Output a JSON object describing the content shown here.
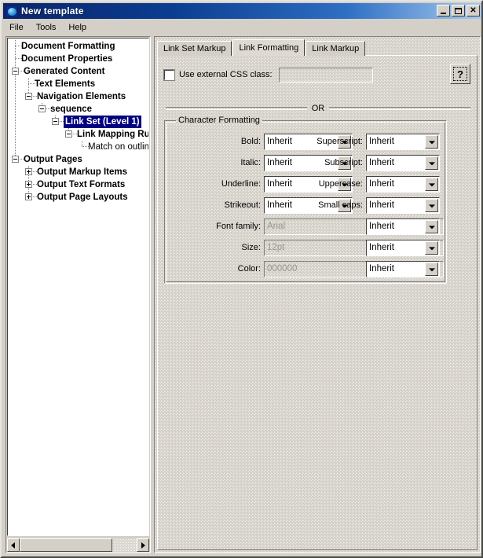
{
  "window": {
    "title": "New template",
    "icon": "globe-icon",
    "buttons": {
      "minimize": "_",
      "maximize": "□",
      "close": "✕"
    }
  },
  "menubar": {
    "items": [
      {
        "label": "File"
      },
      {
        "label": "Tools"
      },
      {
        "label": "Help"
      }
    ]
  },
  "tree": {
    "nodes": [
      {
        "label": "Document Formatting",
        "depth": 0,
        "toggle": "none",
        "bold": true,
        "selected": false
      },
      {
        "label": "Document Properties",
        "depth": 0,
        "toggle": "none",
        "bold": true,
        "selected": false
      },
      {
        "label": "Generated Content",
        "depth": 0,
        "toggle": "minus",
        "bold": true,
        "selected": false
      },
      {
        "label": "Text Elements",
        "depth": 1,
        "toggle": "none",
        "bold": true,
        "selected": false
      },
      {
        "label": "Navigation Elements",
        "depth": 1,
        "toggle": "minus",
        "bold": true,
        "selected": false
      },
      {
        "label": "sequence",
        "depth": 2,
        "toggle": "minus",
        "bold": true,
        "selected": false
      },
      {
        "label": "Link Set (Level 1)",
        "depth": 3,
        "toggle": "minus",
        "bold": true,
        "selected": true
      },
      {
        "label": "Link Mapping Ru",
        "depth": 4,
        "toggle": "minus",
        "bold": true,
        "selected": false
      },
      {
        "label": "Match on outlin",
        "depth": 5,
        "toggle": "none",
        "bold": false,
        "selected": false
      },
      {
        "label": "Output Pages",
        "depth": 0,
        "toggle": "minus",
        "bold": true,
        "selected": false
      },
      {
        "label": "Output Markup Items",
        "depth": 1,
        "toggle": "plus",
        "bold": true,
        "selected": false
      },
      {
        "label": "Output Text Formats",
        "depth": 1,
        "toggle": "plus",
        "bold": true,
        "selected": false
      },
      {
        "label": "Output Page Layouts",
        "depth": 1,
        "toggle": "plus",
        "bold": true,
        "selected": false
      }
    ],
    "scrollbar": {
      "left_arrow": "scroll-left-arrow-icon",
      "right_arrow": "scroll-right-arrow-icon"
    }
  },
  "tabs": [
    {
      "label": "Link Set Markup",
      "active": false
    },
    {
      "label": "Link Formatting",
      "active": true
    },
    {
      "label": "Link Markup",
      "active": false
    }
  ],
  "panel": {
    "css_checkbox_label": "Use external CSS class:",
    "css_checkbox_checked": false,
    "css_field_value": "",
    "css_field_placeholder": "",
    "help_button_glyph": "?",
    "or_label": "OR",
    "group_title": "Character Formatting",
    "left_rows": [
      {
        "label": "Bold:",
        "type": "combo",
        "value": "Inherit"
      },
      {
        "label": "Italic:",
        "type": "combo",
        "value": "Inherit"
      },
      {
        "label": "Underline:",
        "type": "combo",
        "value": "Inherit"
      },
      {
        "label": "Strikeout:",
        "type": "combo",
        "value": "Inherit"
      },
      {
        "label": "Font family:",
        "type": "text",
        "value": "Arial"
      },
      {
        "label": "Size:",
        "type": "text",
        "value": "12pt"
      },
      {
        "label": "Color:",
        "type": "text",
        "value": "000000"
      }
    ],
    "right_rows": [
      {
        "label": "Superscript:",
        "value": "Inherit"
      },
      {
        "label": "Subscript:",
        "value": "Inherit"
      },
      {
        "label": "Uppercase:",
        "value": "Inherit"
      },
      {
        "label": "Small caps:",
        "value": "Inherit"
      },
      {
        "label": "",
        "value": "Inherit"
      },
      {
        "label": "",
        "value": "Inherit"
      },
      {
        "label": "",
        "value": "Inherit"
      }
    ]
  },
  "colors": {
    "face": "#d4d0c8",
    "titlebar_start": "#0a246a",
    "titlebar_end": "#a6caf0",
    "selection": "#000080",
    "disabled_text": "#9a968f"
  }
}
